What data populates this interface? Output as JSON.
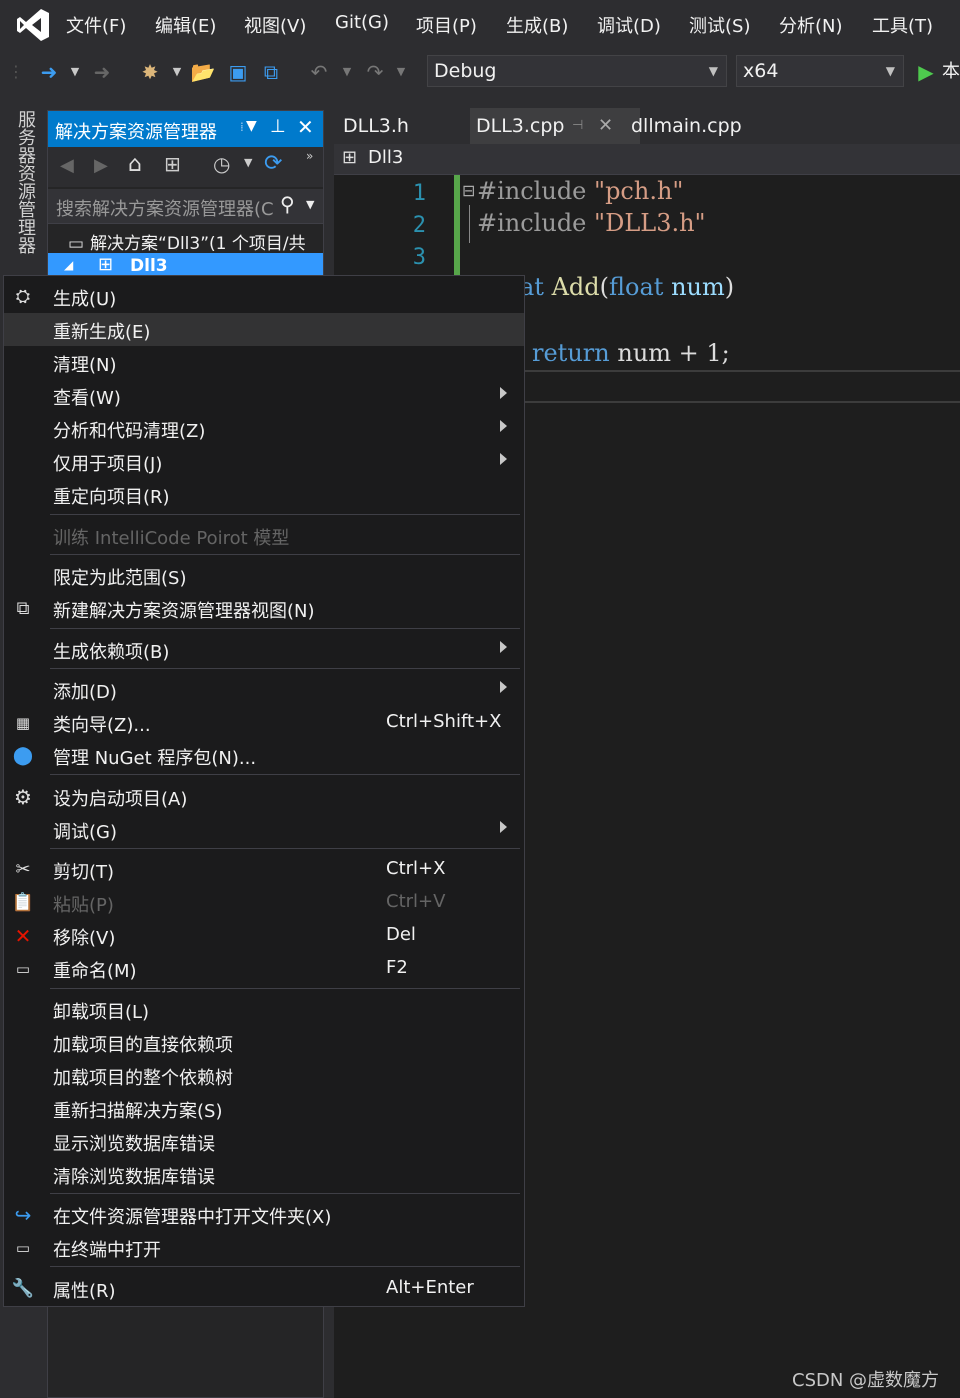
{
  "menubar": {
    "items": [
      "文件(F)",
      "编辑(E)",
      "视图(V)",
      "Git(G)",
      "项目(P)",
      "生成(B)",
      "调试(D)",
      "测试(S)",
      "分析(N)",
      "工具(T)"
    ]
  },
  "toolbar": {
    "config": "Debug",
    "platform": "x64",
    "run_label": "本"
  },
  "side_tab": {
    "label": "服务器资源管理器"
  },
  "solution_explorer": {
    "title": "解决方案资源管理器",
    "search_placeholder": "搜索解决方案资源管理器(C",
    "solution_label": "解决方案“Dll3”(1 个项目/共",
    "project_label": "Dll3"
  },
  "editor": {
    "tabs": [
      "DLL3.h",
      "DLL3.cpp",
      "dllmain.cpp"
    ],
    "active_tab": "DLL3.cpp",
    "nav_project": "Dll3",
    "line_numbers": [
      "1",
      "2",
      "3"
    ],
    "code": {
      "l1_pp": "#include",
      "l1_str": "\"pch.h\"",
      "l2_pp": "#include",
      "l2_str": "\"DLL3.h\"",
      "l4_kw": "at",
      "l4_fn": "Add",
      "l4_paren": "(",
      "l4_type": "float",
      "l4_arg": "num",
      "l4_close": ")",
      "l6_kw": "return",
      "l6_rest": "num + 1;"
    }
  },
  "context_menu": {
    "items": [
      {
        "label": "生成(U)",
        "shortcut": ""
      },
      {
        "label": "重新生成(E)",
        "shortcut": ""
      },
      {
        "label": "清理(N)",
        "shortcut": ""
      },
      {
        "label": "查看(W)",
        "shortcut": ""
      },
      {
        "label": "分析和代码清理(Z)",
        "shortcut": ""
      },
      {
        "label": "仅用于项目(J)",
        "shortcut": ""
      },
      {
        "label": "重定向项目(R)",
        "shortcut": ""
      },
      {
        "label": "训练 IntelliCode Poirot 模型",
        "shortcut": ""
      },
      {
        "label": "限定为此范围(S)",
        "shortcut": ""
      },
      {
        "label": "新建解决方案资源管理器视图(N)",
        "shortcut": ""
      },
      {
        "label": "生成依赖项(B)",
        "shortcut": ""
      },
      {
        "label": "添加(D)",
        "shortcut": ""
      },
      {
        "label": "类向导(Z)...",
        "shortcut": "Ctrl+Shift+X"
      },
      {
        "label": "管理 NuGet 程序包(N)...",
        "shortcut": ""
      },
      {
        "label": "设为启动项目(A)",
        "shortcut": ""
      },
      {
        "label": "调试(G)",
        "shortcut": ""
      },
      {
        "label": "剪切(T)",
        "shortcut": "Ctrl+X"
      },
      {
        "label": "粘贴(P)",
        "shortcut": "Ctrl+V"
      },
      {
        "label": "移除(V)",
        "shortcut": "Del"
      },
      {
        "label": "重命名(M)",
        "shortcut": "F2"
      },
      {
        "label": "卸载项目(L)",
        "shortcut": ""
      },
      {
        "label": "加载项目的直接依赖项",
        "shortcut": ""
      },
      {
        "label": "加载项目的整个依赖树",
        "shortcut": ""
      },
      {
        "label": "重新扫描解决方案(S)",
        "shortcut": ""
      },
      {
        "label": "显示浏览数据库错误",
        "shortcut": ""
      },
      {
        "label": "清除浏览数据库错误",
        "shortcut": ""
      },
      {
        "label": "在文件资源管理器中打开文件夹(X)",
        "shortcut": ""
      },
      {
        "label": "在终端中打开",
        "shortcut": ""
      },
      {
        "label": "属性(R)",
        "shortcut": "Alt+Enter"
      }
    ]
  },
  "watermark": "CSDN @虚数魔方",
  "colors": {
    "accent": "#007acc",
    "selection": "#3399ff",
    "menu_bg": "#1b1b1c",
    "menu_hover": "#333334",
    "line_number": "#2b91af",
    "string": "#d69d85",
    "keyword": "#569cd6"
  }
}
